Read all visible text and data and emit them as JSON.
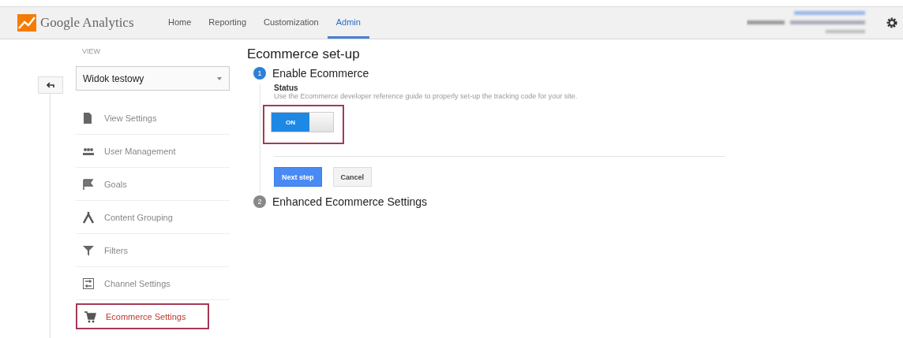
{
  "header": {
    "logo_text": "Google Analytics",
    "nav": [
      {
        "label": "Home",
        "selected": false
      },
      {
        "label": "Reporting",
        "selected": false
      },
      {
        "label": "Customization",
        "selected": false
      },
      {
        "label": "Admin",
        "selected": true
      }
    ]
  },
  "sidebar": {
    "view_label": "VIEW",
    "view_select": "Widok testowy",
    "items": [
      {
        "label": "View Settings",
        "selected": false
      },
      {
        "label": "User Management",
        "selected": false
      },
      {
        "label": "Goals",
        "selected": false
      },
      {
        "label": "Content Grouping",
        "selected": false
      },
      {
        "label": "Filters",
        "selected": false
      },
      {
        "label": "Channel Settings",
        "selected": false
      },
      {
        "label": "Ecommerce Settings",
        "selected": true
      }
    ]
  },
  "content": {
    "title": "Ecommerce set-up",
    "steps": [
      {
        "number": "1",
        "title": "Enable Ecommerce",
        "active": true,
        "status_label": "Status",
        "description": "Use the Ecommerce developer reference guide to properly set-up the tracking code for your site.",
        "toggle": {
          "label": "ON",
          "on": true
        },
        "buttons": [
          {
            "label": "Next step",
            "kind": "primary"
          },
          {
            "label": "Cancel",
            "kind": "secondary"
          }
        ]
      },
      {
        "number": "2",
        "title": "Enhanced Ecommerce Settings",
        "active": false
      }
    ]
  }
}
